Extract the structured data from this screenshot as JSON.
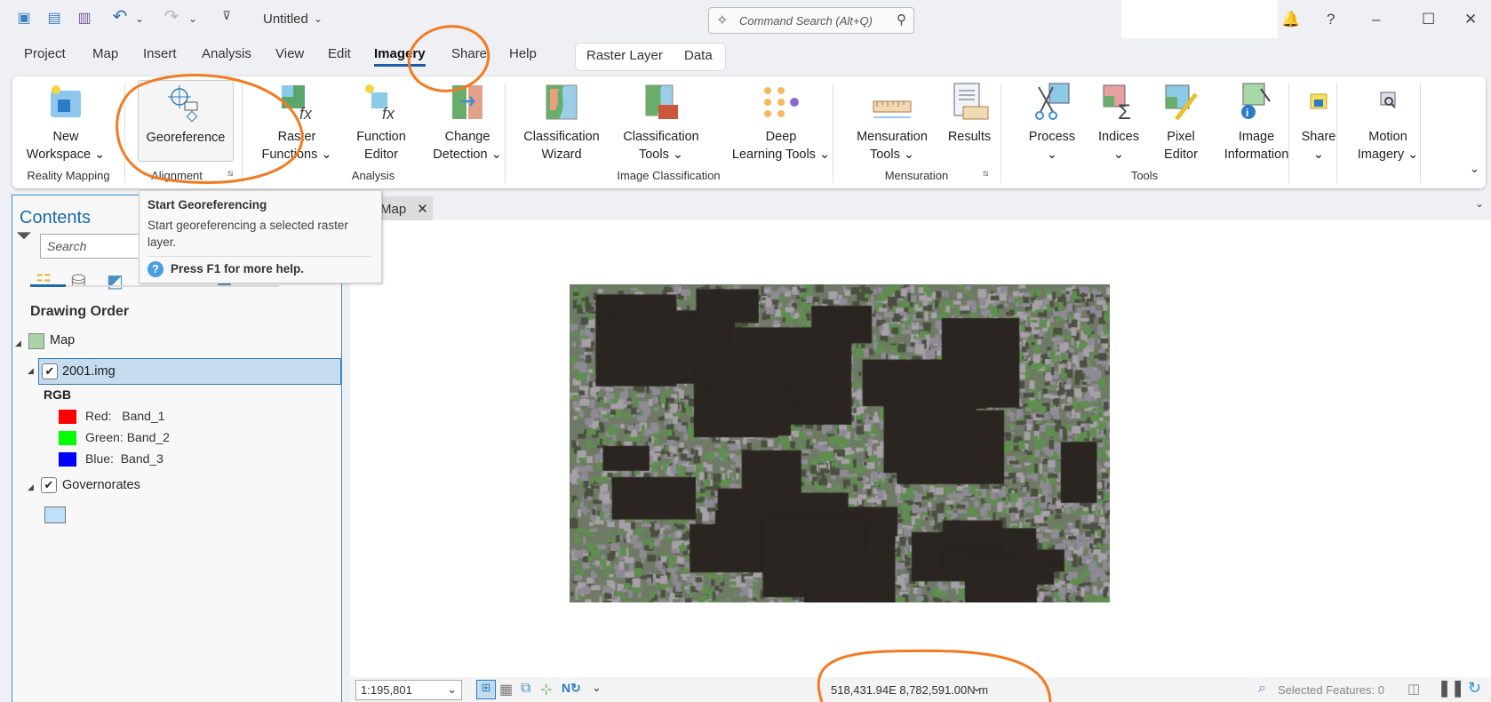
{
  "titlebar": {
    "title": "Untitled",
    "command_search_placeholder": "Command Search (Alt+Q)",
    "help": "?"
  },
  "menu": {
    "tabs": [
      "Project",
      "Map",
      "Insert",
      "Analysis",
      "View",
      "Edit",
      "Imagery",
      "Share",
      "Help"
    ],
    "active": "Imagery",
    "context_tabs": [
      "Raster Layer",
      "Data"
    ]
  },
  "ribbon": {
    "buttons": [
      {
        "l1": "New",
        "l2": "Workspace ⌄"
      },
      {
        "l1": "Georeference",
        "l2": ""
      },
      {
        "l1": "Raster",
        "l2": "Functions ⌄"
      },
      {
        "l1": "Function",
        "l2": "Editor"
      },
      {
        "l1": "Change",
        "l2": "Detection ⌄"
      },
      {
        "l1": "Classification",
        "l2": "Wizard"
      },
      {
        "l1": "Classification",
        "l2": "Tools ⌄"
      },
      {
        "l1": "Deep",
        "l2": "Learning Tools ⌄"
      },
      {
        "l1": "Mensuration",
        "l2": "Tools ⌄"
      },
      {
        "l1": "Results",
        "l2": ""
      },
      {
        "l1": "Process",
        "l2": "⌄"
      },
      {
        "l1": "Indices",
        "l2": "⌄"
      },
      {
        "l1": "Pixel",
        "l2": "Editor"
      },
      {
        "l1": "Image",
        "l2": "Information"
      },
      {
        "l1": "Share",
        "l2": "⌄"
      },
      {
        "l1": "Motion",
        "l2": "Imagery ⌄"
      }
    ],
    "groups": [
      "Reality Mapping",
      "Alignment",
      "Analysis",
      "Image Classification",
      "Mensuration",
      "Tools"
    ]
  },
  "tooltip": {
    "title": "Start Georeferencing",
    "body": "Start georeferencing a selected raster layer.",
    "help": "Press F1 for more help."
  },
  "contents": {
    "title": "Contents",
    "search_placeholder": "Search",
    "section": "Drawing Order",
    "map": "Map",
    "layer": "2001.img",
    "renderer": "RGB",
    "bands": [
      {
        "label": "Red:   Band_1",
        "color": "#ff0000"
      },
      {
        "label": "Green: Band_2",
        "color": "#00ff00"
      },
      {
        "label": "Blue:  Band_3",
        "color": "#0000ff"
      }
    ],
    "layer2": "Governorates",
    "layer2_color": "#bee0f8"
  },
  "map_tab": {
    "label": "Map"
  },
  "statusbar": {
    "scale": "1:195,801",
    "coords": "518,431.94E 8,782,591.00N m",
    "selected": "Selected Features: 0"
  },
  "colors": {
    "accent": "#1a5fa8",
    "annotation": "#f47a20",
    "selection": "#c5dcef"
  }
}
